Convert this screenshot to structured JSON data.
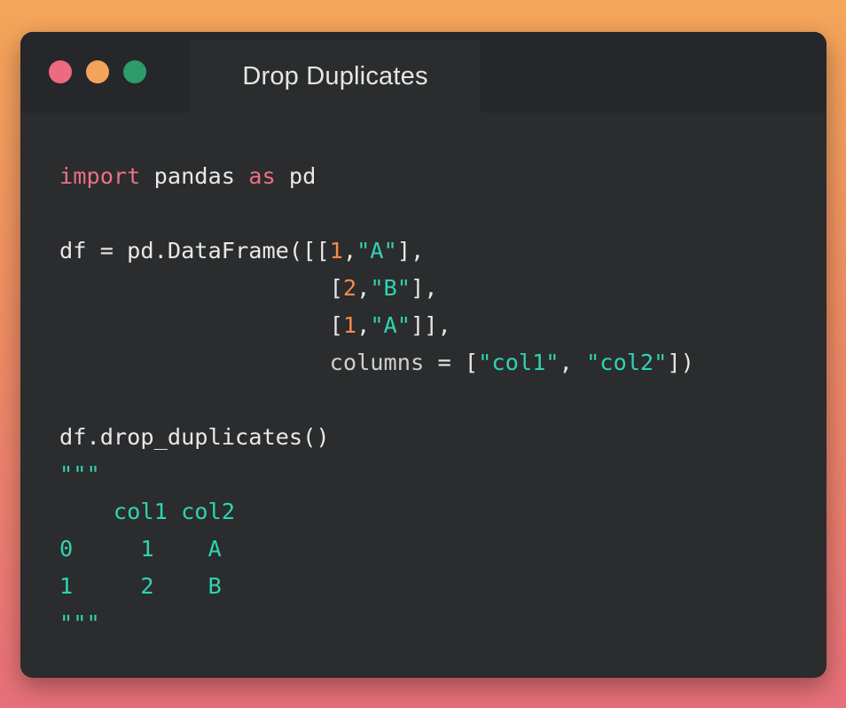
{
  "window": {
    "title": "Drop Duplicates",
    "controls": {
      "close_color": "#ec6b82",
      "minimize_color": "#f4a35a",
      "maximize_color": "#2f9a6a"
    }
  },
  "colors": {
    "keyword": "#ec6f86",
    "number": "#f58a4b",
    "string": "#2fd3b3",
    "text": "#e8e8e8"
  },
  "code": {
    "l1": {
      "kw1": "import",
      "t1": " pandas ",
      "kw2": "as",
      "t2": " pd"
    },
    "l3": {
      "t1": "df = pd.DataFrame([[",
      "n1": "1",
      "c1": ",",
      "s1": "\"A\"",
      "t2": "],"
    },
    "l4": {
      "indent": "                    [",
      "n1": "2",
      "c1": ",",
      "s1": "\"B\"",
      "t2": "],"
    },
    "l5": {
      "indent": "                    [",
      "n1": "1",
      "c1": ",",
      "s1": "\"A\"",
      "t2": "]],"
    },
    "l6": {
      "indent": "                    ",
      "p1": "columns",
      "t1": " = [",
      "s1": "\"col1\"",
      "t2": ", ",
      "s2": "\"col2\"",
      "t3": "])"
    },
    "l8": {
      "t1": "df.drop_duplicates()"
    },
    "l9": {
      "out": "\"\"\""
    },
    "l10": {
      "out": "    col1 col2"
    },
    "l11": {
      "out": "0     1    A"
    },
    "l12": {
      "out": "1     2    B"
    },
    "l13": {
      "out": "\"\"\""
    }
  }
}
